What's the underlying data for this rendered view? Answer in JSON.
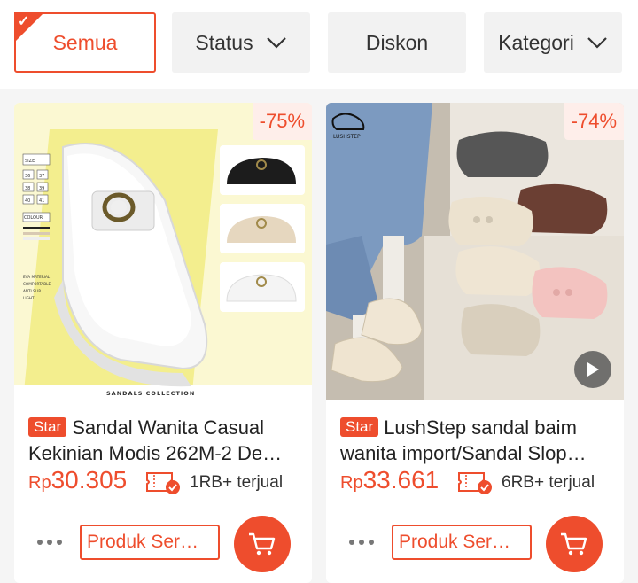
{
  "filters": {
    "semua": "Semua",
    "status": "Status",
    "diskon": "Diskon",
    "kategori": "Kategori"
  },
  "products": [
    {
      "discount": "-75%",
      "star": "Star",
      "title": "Sandal Wanita Casual Kekinian Modis 262M-2 De…",
      "currency": "Rp",
      "price": "30.305",
      "sold": "1RB+ terjual",
      "similar": "Produk Ser…",
      "image_labels": {
        "size_header": "SIZE",
        "sizes": [
          "36",
          "37",
          "38",
          "39",
          "40",
          "41"
        ],
        "colour": "COLOUR",
        "features": [
          "EVA MATERIAL",
          "COMFORTABLE",
          "ANTI SLIP",
          "LIGHT"
        ],
        "collection": "SANDALS COLLECTION"
      }
    },
    {
      "discount": "-74%",
      "star": "Star",
      "title": "LushStep sandal baim wanita import/Sandal Slop…",
      "currency": "Rp",
      "price": "33.661",
      "sold": "6RB+ terjual",
      "similar": "Produk Ser…",
      "image_labels": {
        "brand": "LUSHSTEP"
      }
    }
  ],
  "colors": {
    "accent": "#ee4d2d",
    "discount_bg": "#feeeea",
    "yellow_bg": "#f4f0a0"
  }
}
